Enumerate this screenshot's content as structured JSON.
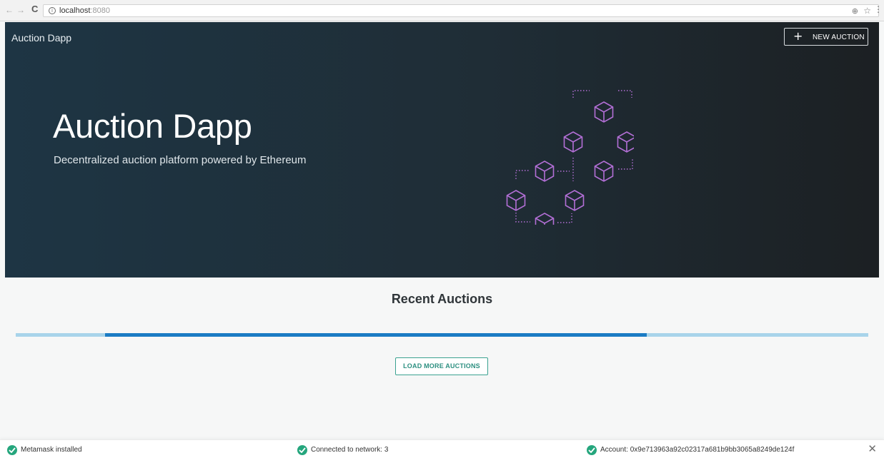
{
  "browser": {
    "back_icon": "arrow-left-icon",
    "forward_icon": "arrow-right-icon",
    "reload_icon": "reload-icon",
    "url_host": "localhost",
    "url_port": ":8080",
    "zoom_icon": "zoom-icon",
    "star_icon": "star-icon",
    "menu_icon": "more-vert-icon"
  },
  "header": {
    "brand": "Auction Dapp",
    "new_auction_label": "NEW AUCTION"
  },
  "hero": {
    "title": "Auction Dapp",
    "subtitle": "Decentralized auction platform powered by Ethereum",
    "art_icon": "blockchain-network-icon",
    "art_color": "#b36fd6"
  },
  "main": {
    "section_title": "Recent Auctions",
    "progress_start": 0.105,
    "progress_end": 0.74,
    "load_more_label": "LOAD MORE AUCTIONS"
  },
  "status_bar": {
    "items": [
      {
        "label": "Metamask installed",
        "icon": "check-circle-icon"
      },
      {
        "label": "Connected to network: 3",
        "icon": "check-circle-icon"
      },
      {
        "label": "Account: 0x9e713963a92c02317a681b9bb3065a8249de124f",
        "icon": "check-circle-icon"
      }
    ],
    "close_icon": "close-icon"
  },
  "colors": {
    "accent": "#1b7cc4",
    "success": "#25a67d",
    "button_outline": "#3aa290"
  }
}
